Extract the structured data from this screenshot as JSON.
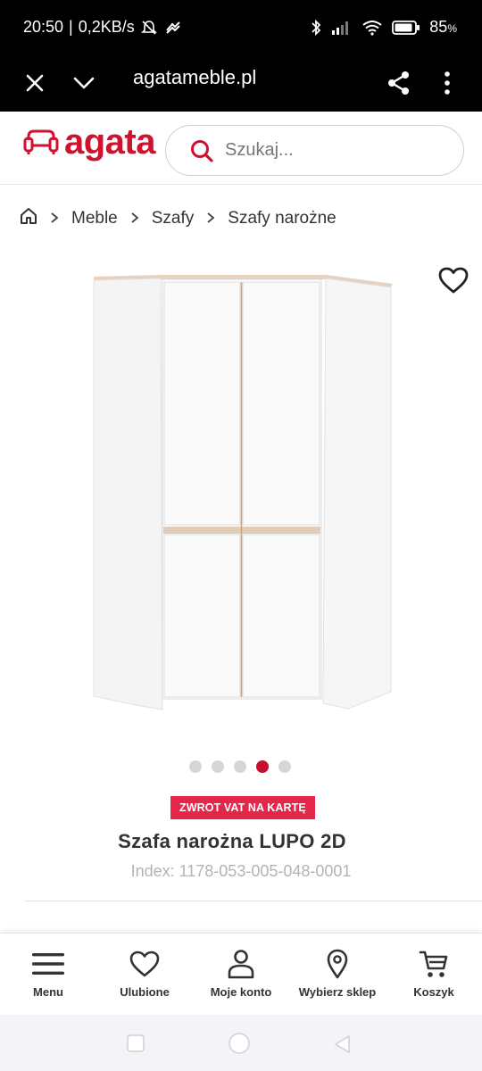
{
  "status_bar": {
    "time": "20:50",
    "network_speed": "0,2KB/s",
    "battery": "85"
  },
  "browser": {
    "url": "agatameble.pl"
  },
  "header": {
    "logo_text": "agata",
    "search_placeholder": "Szukaj..."
  },
  "breadcrumb": {
    "items": [
      "Meble",
      "Szafy",
      "Szafy narożne"
    ]
  },
  "carousel": {
    "count": 5,
    "active_index": 3
  },
  "product": {
    "badge": "ZWROT VAT NA KARTĘ",
    "title": "Szafa narożna LUPO 2D",
    "index": "Index: 1178-053-005-048-0001"
  },
  "bottom_nav": {
    "items": [
      {
        "label": "Menu",
        "icon": "menu-icon"
      },
      {
        "label": "Ulubione",
        "icon": "heart-icon"
      },
      {
        "label": "Moje konto",
        "icon": "user-icon"
      },
      {
        "label": "Wybierz sklep",
        "icon": "location-pin-icon"
      },
      {
        "label": "Koszyk",
        "icon": "cart-icon"
      }
    ]
  },
  "colors": {
    "brand": "#d1122e",
    "badge": "#e3264a",
    "active_dot": "#c8102e"
  }
}
